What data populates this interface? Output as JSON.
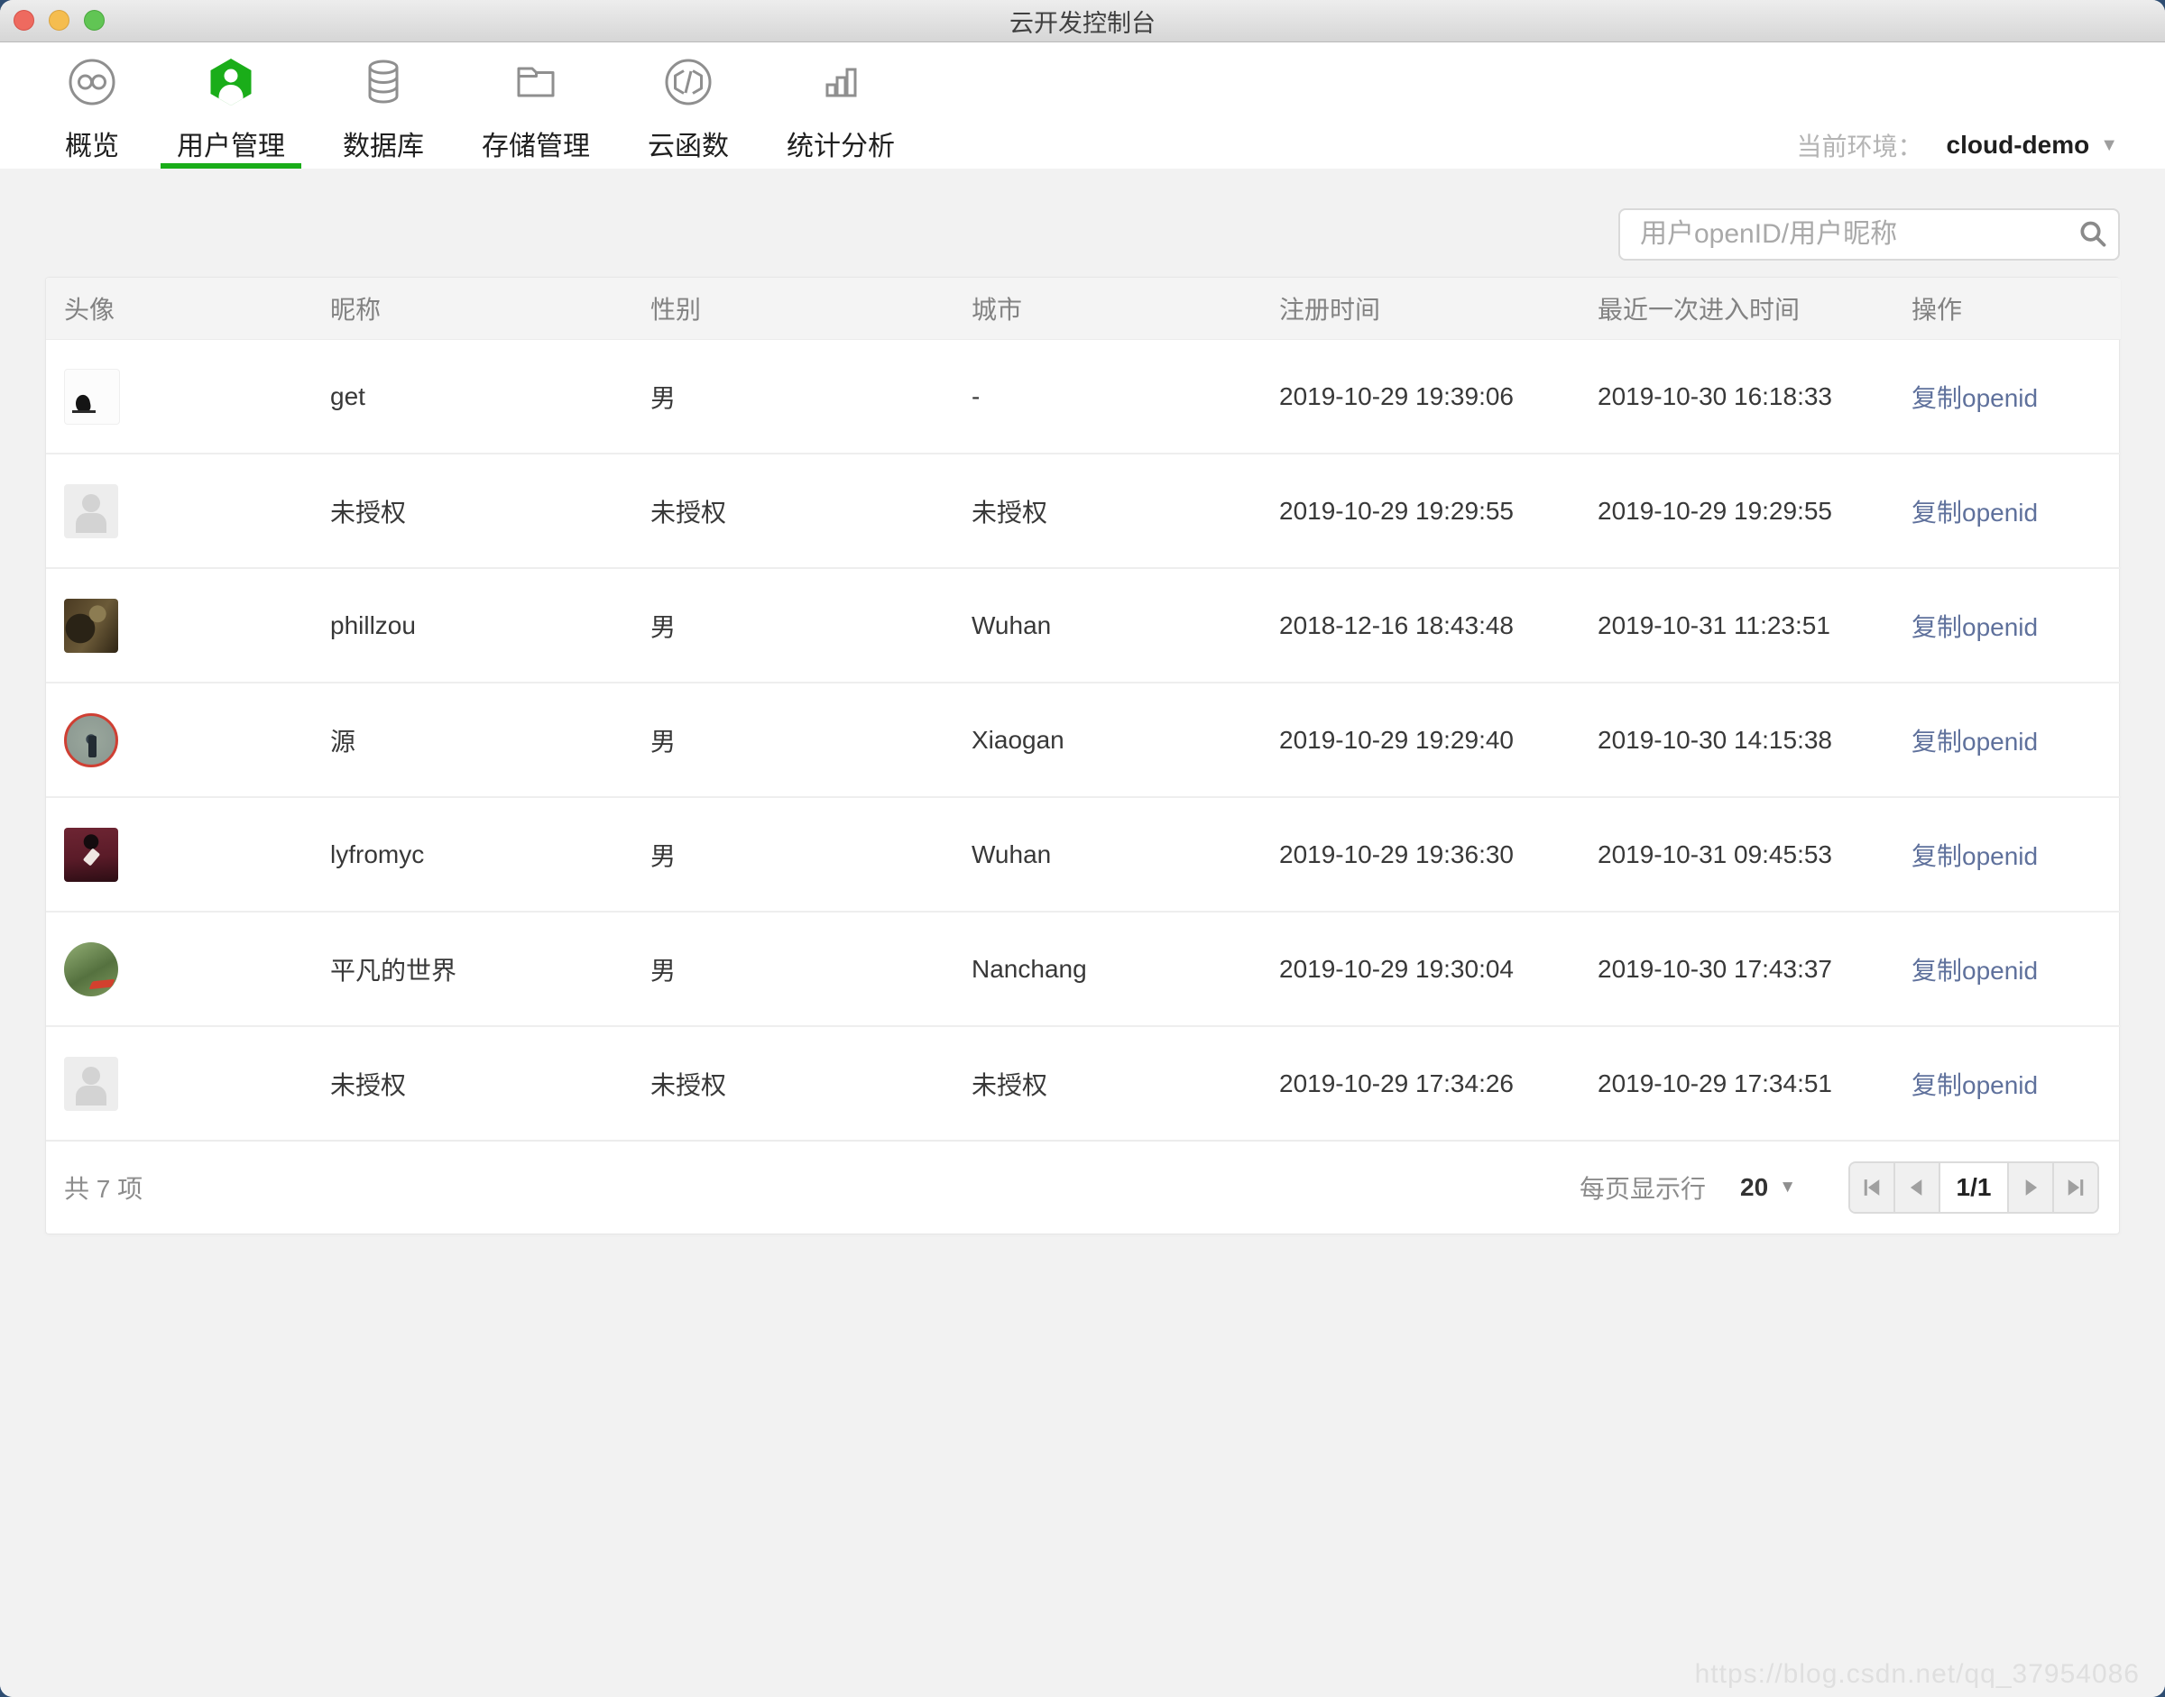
{
  "window": {
    "title": "云开发控制台"
  },
  "nav": {
    "tabs": [
      {
        "label": "概览",
        "icon": "overview-icon",
        "active": false
      },
      {
        "label": "用户管理",
        "icon": "user-management-icon",
        "active": true
      },
      {
        "label": "数据库",
        "icon": "database-icon",
        "active": false
      },
      {
        "label": "存储管理",
        "icon": "storage-icon",
        "active": false
      },
      {
        "label": "云函数",
        "icon": "cloud-function-icon",
        "active": false
      },
      {
        "label": "统计分析",
        "icon": "statistics-icon",
        "active": false
      }
    ],
    "env_label": "当前环境：",
    "env_value": "cloud-demo"
  },
  "search": {
    "placeholder": "用户openID/用户昵称"
  },
  "table": {
    "columns": [
      "头像",
      "昵称",
      "性别",
      "城市",
      "注册时间",
      "最近一次进入时间",
      "操作"
    ],
    "action_label": "复制openid",
    "rows": [
      {
        "avatar": "bird-on-white",
        "nickname": "get",
        "gender": "男",
        "city": "-",
        "registered": "2019-10-29 19:39:06",
        "last_seen": "2019-10-30 16:18:33"
      },
      {
        "avatar": "default-placeholder",
        "nickname": "未授权",
        "gender": "未授权",
        "city": "未授权",
        "registered": "2019-10-29 19:29:55",
        "last_seen": "2019-10-29 19:29:55"
      },
      {
        "avatar": "guitarist-photo",
        "nickname": "phillzou",
        "gender": "男",
        "city": "Wuhan",
        "registered": "2018-12-16 18:43:48",
        "last_seen": "2019-10-31 11:23:51"
      },
      {
        "avatar": "red-ring-photo",
        "nickname": "源",
        "gender": "男",
        "city": "Xiaogan",
        "registered": "2019-10-29 19:29:40",
        "last_seen": "2019-10-30 14:15:38"
      },
      {
        "avatar": "maroon-portrait",
        "nickname": "lyfromyc",
        "gender": "男",
        "city": "Wuhan",
        "registered": "2019-10-29 19:36:30",
        "last_seen": "2019-10-31 09:45:53"
      },
      {
        "avatar": "green-ring-photo",
        "nickname": "平凡的世界",
        "gender": "男",
        "city": "Nanchang",
        "registered": "2019-10-29 19:30:04",
        "last_seen": "2019-10-30 17:43:37"
      },
      {
        "avatar": "default-placeholder",
        "nickname": "未授权",
        "gender": "未授权",
        "city": "未授权",
        "registered": "2019-10-29 17:34:26",
        "last_seen": "2019-10-29 17:34:51"
      }
    ]
  },
  "footer": {
    "total_label": "共 7 项",
    "page_size_label": "每页显示行",
    "page_size": "20",
    "page_indicator": "1/1"
  },
  "watermark": "https://blog.csdn.net/qq_37954086",
  "colors": {
    "accent_green": "#1aad19",
    "link_blue": "#5f719c"
  }
}
